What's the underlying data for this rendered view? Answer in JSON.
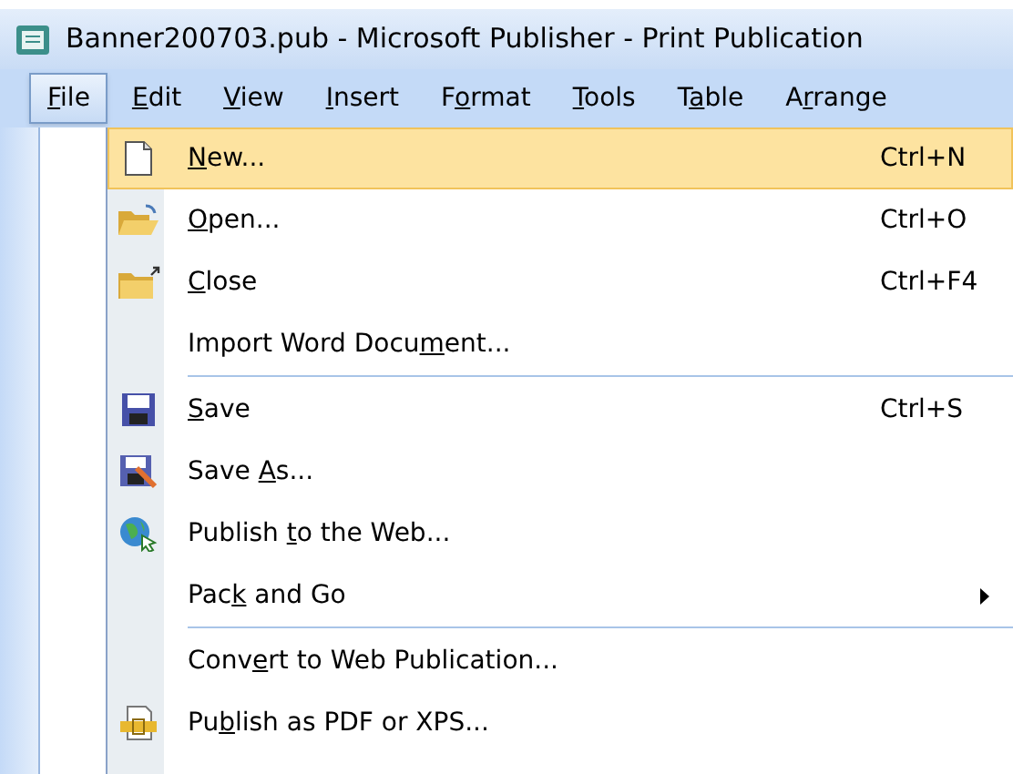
{
  "window": {
    "title": "Banner200703.pub - Microsoft Publisher - Print Publication"
  },
  "menubar": [
    {
      "key": "F",
      "post": "ile",
      "selected": true
    },
    {
      "key": "E",
      "post": "dit",
      "selected": false
    },
    {
      "key": "V",
      "post": "iew",
      "selected": false
    },
    {
      "key": "I",
      "post": "nsert",
      "selected": false
    },
    {
      "pre": "F",
      "key": "o",
      "post": "rmat",
      "selected": false
    },
    {
      "key": "T",
      "post": "ools",
      "selected": false
    },
    {
      "pre": "T",
      "key": "a",
      "post": "ble",
      "selected": false
    },
    {
      "pre": "A",
      "key": "r",
      "post": "range",
      "selected": false
    }
  ],
  "menu": [
    {
      "kind": "item",
      "key": "N",
      "post": "ew...",
      "shortcut": "Ctrl+N",
      "selected": true,
      "submenu": false
    },
    {
      "kind": "item",
      "key": "O",
      "post": "pen...",
      "shortcut": "Ctrl+O",
      "selected": false,
      "submenu": false
    },
    {
      "kind": "item",
      "key": "C",
      "post": "lose",
      "shortcut": "Ctrl+F4",
      "selected": false,
      "submenu": false
    },
    {
      "kind": "item",
      "pre": "Import Word Docu",
      "key": "m",
      "post": "ent...",
      "selected": false,
      "submenu": false
    },
    {
      "kind": "separator"
    },
    {
      "kind": "item",
      "key": "S",
      "post": "ave",
      "shortcut": "Ctrl+S",
      "selected": false,
      "submenu": false
    },
    {
      "kind": "item",
      "pre": "Save ",
      "key": "A",
      "post": "s...",
      "selected": false,
      "submenu": false
    },
    {
      "kind": "item",
      "pre": "Publish ",
      "key": "t",
      "post": "o the Web...",
      "selected": false,
      "submenu": false
    },
    {
      "kind": "item",
      "pre": "Pac",
      "key": "k",
      "post": " and Go",
      "selected": false,
      "submenu": true
    },
    {
      "kind": "separator"
    },
    {
      "kind": "item",
      "pre": "Conv",
      "key": "e",
      "post": "rt to Web Publication...",
      "selected": false,
      "submenu": false
    },
    {
      "kind": "item",
      "pre": "Pu",
      "key": "b",
      "post": "lish as PDF or XPS...",
      "selected": false,
      "submenu": false
    }
  ]
}
